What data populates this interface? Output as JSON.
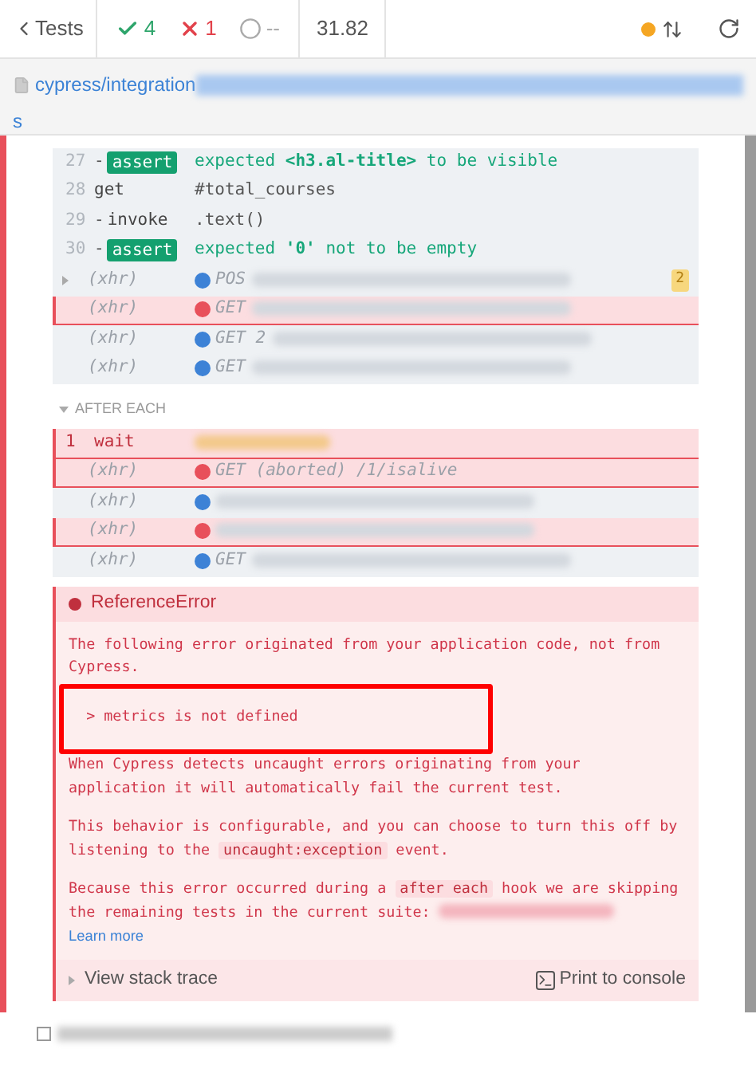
{
  "header": {
    "back": "Tests",
    "passed": "4",
    "failed": "1",
    "pending": "--",
    "duration": "31.82",
    "running": true
  },
  "spec_path": {
    "head": "cypress/integration",
    "tail": "s"
  },
  "test_failed": true,
  "commands": [
    {
      "kind": "command",
      "number": "27",
      "prefix": "-",
      "name": "assert",
      "badge": true,
      "message": "expected **<h3.al-title>** to be visible",
      "failed": false
    },
    {
      "kind": "command",
      "number": "28",
      "name": "get",
      "badge": false,
      "message": "#total_courses",
      "failed": false
    },
    {
      "kind": "command",
      "number": "29",
      "prefix": "-",
      "name": "invoke",
      "badge": false,
      "message": ".text()",
      "failed": false
    },
    {
      "kind": "command",
      "number": "30",
      "prefix": "-",
      "name": "assert",
      "badge": true,
      "message": "expected **'0'** not to be empty",
      "failed": false
    },
    {
      "kind": "xhr",
      "name": "(xhr)",
      "expandable": true,
      "color": "#3d82d6",
      "method": "POS",
      "count": "2",
      "failed": false
    },
    {
      "kind": "xhr",
      "name": "(xhr)",
      "expandable": false,
      "color": "#e8505b",
      "method": "GET",
      "failed": true
    },
    {
      "kind": "xhr",
      "name": "(xhr)",
      "expandable": false,
      "color": "#3d82d6",
      "method": "GET 2",
      "failed": false
    },
    {
      "kind": "xhr",
      "name": "(xhr)",
      "expandable": false,
      "color": "#3d82d6",
      "method": "GET",
      "failed": false
    }
  ],
  "hook": {
    "title": "AFTER EACH",
    "expanded": true,
    "commands": [
      {
        "kind": "command",
        "number": "1",
        "name": "wait",
        "badge": false,
        "failed": true
      },
      {
        "kind": "xhr",
        "name": "(xhr)",
        "expandable": false,
        "color": "#e8505b",
        "method": "GET (aborted) /1/isalive",
        "failed": true
      },
      {
        "kind": "xhr",
        "name": "(xhr)",
        "expandable": false,
        "color": "#3d82d6",
        "failed": false
      },
      {
        "kind": "xhr",
        "name": "(xhr)",
        "expandable": false,
        "color": "#e8505b",
        "failed": true
      },
      {
        "kind": "xhr",
        "name": "(xhr)",
        "expandable": false,
        "color": "#3d82d6",
        "method": "GET",
        "failed": false
      }
    ]
  },
  "error": {
    "name": "ReferenceError",
    "paragraphs": [
      {
        "highlighted": false,
        "parts": [
          {
            "kind": "text",
            "text": "The following error originated from your application code, not from Cypress."
          }
        ]
      },
      {
        "highlighted": true,
        "parts": [
          {
            "kind": "text",
            "text": "  > metrics is not defined"
          }
        ]
      },
      {
        "highlighted": false,
        "parts": [
          {
            "kind": "text",
            "text": "When Cypress detects uncaught errors originating from your application it will automatically fail the current test."
          }
        ]
      },
      {
        "highlighted": false,
        "parts": [
          {
            "kind": "text",
            "text": "This behavior is configurable, and you can choose to turn this off by listening to the "
          },
          {
            "kind": "code",
            "text": "uncaught:exception"
          },
          {
            "kind": "text",
            "text": " event."
          }
        ]
      },
      {
        "highlighted": false,
        "parts": [
          {
            "kind": "text",
            "text": "Because this error occurred during a "
          },
          {
            "kind": "code",
            "text": "after each"
          },
          {
            "kind": "text",
            "text": " hook we are skipping the remaining tests in the current suite: "
          },
          {
            "kind": "redacted"
          },
          {
            "kind": "link",
            "text": "Learn more"
          }
        ]
      }
    ],
    "stack_trace": "View stack trace",
    "print": "Print to console"
  },
  "next_test": {
    "checked": false
  }
}
